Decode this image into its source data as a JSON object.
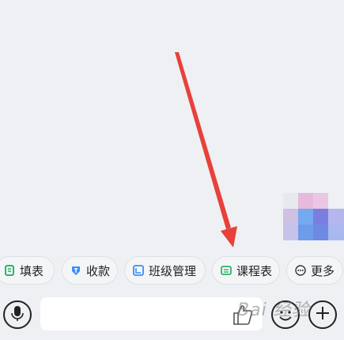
{
  "quick_tools": {
    "fill_form": {
      "label": "填表",
      "icon": "form-icon",
      "color": "#2fb36a"
    },
    "collect_payment": {
      "label": "收款",
      "icon": "payment-icon",
      "color": "#3b8ff3"
    },
    "class_management": {
      "label": "班级管理",
      "icon": "class-icon",
      "color": "#3b8ff3"
    },
    "schedule": {
      "label": "课程表",
      "icon": "schedule-icon",
      "color": "#2fb36a"
    },
    "more": {
      "label": "更多",
      "icon": "more-icon",
      "color": "#333333"
    }
  },
  "input_bar": {
    "placeholder": "",
    "mic_icon": "microphone-icon",
    "like_icon": "thumbs-up-icon",
    "emoji_icon": "emoji-icon",
    "add_icon": "plus-icon"
  },
  "annotation": {
    "color": "#e8403a"
  },
  "watermark": {
    "text": "Bai 经验"
  }
}
